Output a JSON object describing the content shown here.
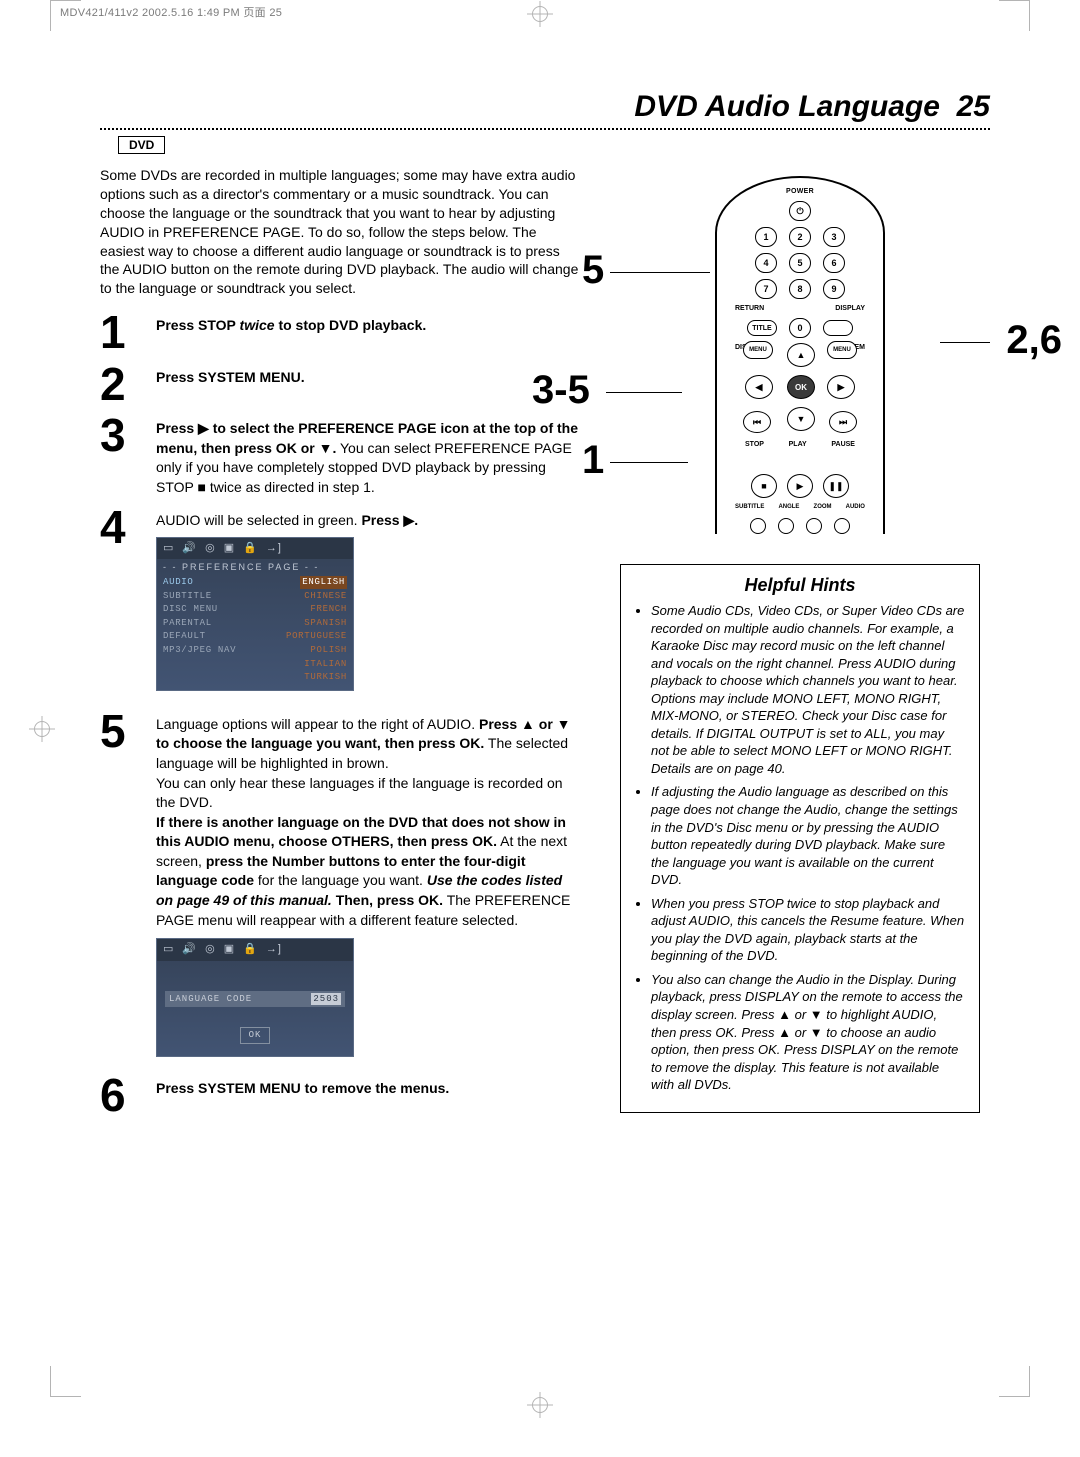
{
  "meta_header": "MDV421/411v2  2002.5.16  1:49 PM  页面 25",
  "page_title": "DVD Audio Language",
  "page_number": "25",
  "dvd_chip": "DVD",
  "intro": "Some DVDs are recorded in multiple languages; some may have extra audio options such as a director's commentary or a music soundtrack. You can choose the language or the soundtrack that you want to hear by adjusting AUDIO in PREFERENCE PAGE.  To do so, follow the steps below. The easiest way to choose a different audio language or soundtrack is to press the AUDIO button on the remote during DVD playback. The audio will change to the language or soundtrack you select.",
  "steps": {
    "n1": "1",
    "s1a": "Press STOP ",
    "s1b": "twice",
    "s1c": " to stop DVD playback.",
    "n2": "2",
    "s2": "Press SYSTEM MENU.",
    "n3": "3",
    "s3a": "Press ▶ to select the PREFERENCE PAGE icon at the top of the menu, then press OK or ▼.",
    "s3b": " You can select PREFERENCE PAGE only if you have completely stopped DVD playback by pressing STOP ■ twice as directed in step 1.",
    "n4": "4",
    "s4a": "AUDIO will be selected in green. ",
    "s4b": "Press ▶.",
    "n5": "5",
    "s5a": "Language options will appear to the right of AUDIO. ",
    "s5b": "Press ▲ or ▼ to choose the language you want, then press OK.",
    "s5c": " The selected language will be highlighted in brown.",
    "s5d": "You can only hear these languages if the language is recorded on the DVD.",
    "s5e": "If there is another language on the DVD that does not show in this AUDIO menu, choose OTHERS, then press OK.",
    "s5f": " At the next screen, ",
    "s5g": "press the Number buttons to enter the four-digit language code",
    "s5h": " for the language you want. ",
    "s5i": "Use the codes listed on page 49 of this manual.",
    "s5j": " Then, press OK.",
    "s5k": " The PREFERENCE PAGE menu will reappear with a different feature selected.",
    "n6": "6",
    "s6": "Press SYSTEM MENU to remove the menus."
  },
  "pref_screenshot": {
    "header": "- -  PREFERENCE  PAGE  - -",
    "rows": [
      {
        "l": "AUDIO",
        "r": "ENGLISH",
        "sel": true
      },
      {
        "l": "SUBTITLE",
        "r": "CHINESE"
      },
      {
        "l": "DISC MENU",
        "r": "FRENCH"
      },
      {
        "l": "PARENTAL",
        "r": "SPANISH"
      },
      {
        "l": "DEFAULT",
        "r": "PORTUGUESE"
      },
      {
        "l": "MP3/JPEG NAV",
        "r": "POLISH"
      },
      {
        "l": "",
        "r": "ITALIAN"
      },
      {
        "l": "",
        "r": "TURKISH"
      }
    ]
  },
  "code_screenshot": {
    "label": "LANGUAGE CODE",
    "value": "2503",
    "ok": "OK"
  },
  "remote": {
    "power": "POWER",
    "nums": [
      "1",
      "2",
      "3",
      "4",
      "5",
      "6",
      "7",
      "8",
      "9",
      "0"
    ],
    "return": "RETURN",
    "display": "DISPLAY",
    "title": "TITLE",
    "disc": "DISC",
    "system": "SYSTEM",
    "menu": "MENU",
    "ok": "OK",
    "stop": "STOP",
    "play": "PLAY",
    "pause": "PAUSE",
    "sub": "SUBTITLE",
    "angle": "ANGLE",
    "zoom": "ZOOM",
    "audio": "AUDIO"
  },
  "callouts": {
    "c5": "5",
    "c35": "3-5",
    "c1": "1",
    "c26": "2,6"
  },
  "hints_title": "Helpful Hints",
  "hints": [
    "Some Audio CDs, Video CDs, or Super Video CDs are recorded on multiple audio channels. For example, a Karaoke Disc may record music on the left channel and vocals on the right channel. Press AUDIO during playback to choose which channels you want to hear. Options may include MONO LEFT, MONO RIGHT, MIX-MONO, or STEREO. Check your Disc case for details. If DIGITAL OUTPUT is set to ALL, you may not be able to select MONO LEFT or MONO RIGHT. Details are on page 40.",
    "If adjusting the Audio language as described on this page does not change the Audio, change the settings in the DVD's Disc menu or by pressing the AUDIO button repeatedly during DVD playback. Make sure the language you want is available on the current DVD.",
    "When you press STOP twice to stop playback and adjust AUDIO, this cancels the Resume feature. When you play the DVD again, playback starts at the beginning of the DVD.",
    "You also can change the Audio in the Display. During playback, press DISPLAY on the remote to access the display screen. Press ▲ or ▼ to highlight AUDIO, then press OK. Press ▲ or ▼ to choose an audio option, then press OK. Press DISPLAY on the remote to remove the display.  This feature is not available with all DVDs."
  ]
}
